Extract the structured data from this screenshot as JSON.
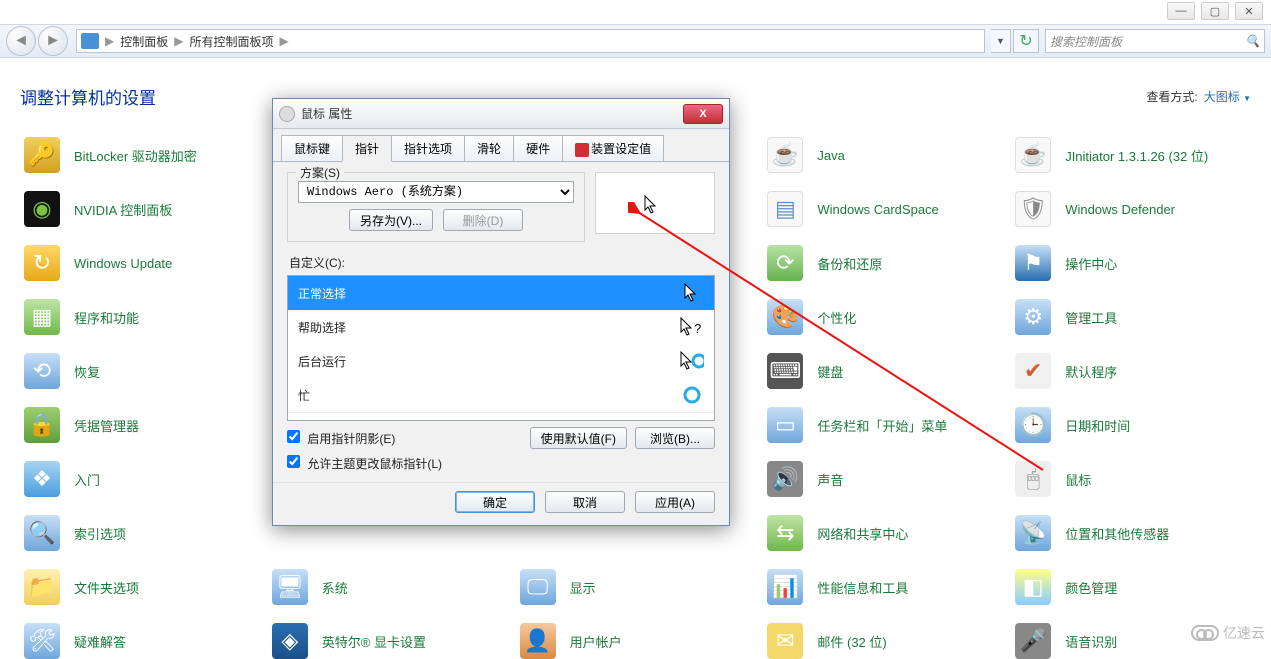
{
  "window_buttons": {
    "min": "—",
    "max": "▢",
    "close": "✕"
  },
  "breadcrumbs": {
    "seg1": "控制面板",
    "seg2": "所有控制面板项",
    "arrow": "▶"
  },
  "search_placeholder": "搜索控制面板",
  "page_title": "调整计算机的设置",
  "view_mode": {
    "label": "查看方式:",
    "value": "大图标",
    "tri": "▼"
  },
  "items": {
    "c0": [
      {
        "label": "BitLocker 驱动器加密",
        "cls": "ic-bitlocker",
        "g": "🔑"
      },
      {
        "label": "NVIDIA 控制面板",
        "cls": "ic-nvidia",
        "g": "◉"
      },
      {
        "label": "Windows Update",
        "cls": "ic-update",
        "g": "↻"
      },
      {
        "label": "程序和功能",
        "cls": "ic-programs",
        "g": "▦"
      },
      {
        "label": "恢复",
        "cls": "ic-recovery",
        "g": "⟲"
      },
      {
        "label": "凭据管理器",
        "cls": "ic-cred",
        "g": "🔒"
      },
      {
        "label": "入门",
        "cls": "ic-intro",
        "g": "❖"
      },
      {
        "label": "索引选项",
        "cls": "ic-index",
        "g": "🔍"
      },
      {
        "label": "文件夹选项",
        "cls": "ic-folder",
        "g": "📁"
      },
      {
        "label": "疑难解答",
        "cls": "ic-trouble",
        "g": "🛠"
      }
    ],
    "c1": [
      {
        "label": "系统",
        "cls": "ic-system",
        "g": "🖥"
      },
      {
        "label": "英特尔® 显卡设置",
        "cls": "ic-intel",
        "g": "◈"
      }
    ],
    "c2": [
      {
        "label": "显示",
        "cls": "ic-display",
        "g": "🖵"
      },
      {
        "label": "用户帐户",
        "cls": "ic-user",
        "g": "👤"
      }
    ],
    "c3": [
      {
        "label": "Java",
        "cls": "ic-java",
        "g": "☕"
      },
      {
        "label": "Windows CardSpace",
        "cls": "ic-cardspace",
        "g": "▤"
      },
      {
        "label": "备份和还原",
        "cls": "ic-backup",
        "g": "⟳"
      },
      {
        "label": "个性化",
        "cls": "ic-personal",
        "g": "🎨"
      },
      {
        "label": "键盘",
        "cls": "ic-keyboard",
        "g": "⌨"
      },
      {
        "label": "任务栏和「开始」菜单",
        "cls": "ic-taskbar",
        "g": "▭"
      },
      {
        "label": "声音",
        "cls": "ic-sound",
        "g": "🔊"
      },
      {
        "label": "网络和共享中心",
        "cls": "ic-network",
        "g": "⇆"
      },
      {
        "label": "性能信息和工具",
        "cls": "ic-perf",
        "g": "📊"
      },
      {
        "label": "邮件 (32 位)",
        "cls": "ic-mail",
        "g": "✉"
      }
    ],
    "c4": [
      {
        "label": "JInitiator 1.3.1.26 (32 位)",
        "cls": "ic-jinit",
        "g": "☕"
      },
      {
        "label": "Windows Defender",
        "cls": "ic-defender",
        "g": "🛡"
      },
      {
        "label": "操作中心",
        "cls": "ic-action",
        "g": "⚑"
      },
      {
        "label": "管理工具",
        "cls": "ic-admin",
        "g": "⚙"
      },
      {
        "label": "默认程序",
        "cls": "ic-default",
        "g": "✔"
      },
      {
        "label": "日期和时间",
        "cls": "ic-date",
        "g": "🕒"
      },
      {
        "label": "鼠标",
        "cls": "ic-mouse",
        "g": "🖱"
      },
      {
        "label": "位置和其他传感器",
        "cls": "ic-location",
        "g": "📡"
      },
      {
        "label": "颜色管理",
        "cls": "ic-color",
        "g": "◧"
      },
      {
        "label": "语音识别",
        "cls": "ic-speech",
        "g": "🎤"
      }
    ]
  },
  "dialog": {
    "title": "鼠标 属性",
    "tabs": [
      "鼠标键",
      "指针",
      "指针选项",
      "滑轮",
      "硬件",
      "装置设定值"
    ],
    "active_tab": 1,
    "scheme_legend": "方案(S)",
    "scheme_value": "Windows Aero (系统方案)",
    "save_as": "另存为(V)...",
    "delete": "删除(D)",
    "custom_label": "自定义(C):",
    "cursors": [
      {
        "name": "正常选择",
        "icon": "arrow",
        "selected": true
      },
      {
        "name": "帮助选择",
        "icon": "help"
      },
      {
        "name": "后台运行",
        "icon": "appwait"
      },
      {
        "name": "忙",
        "icon": "wait"
      }
    ],
    "shadow_chk": "启用指针阴影(E)",
    "theme_chk": "允许主题更改鼠标指针(L)",
    "use_default": "使用默认值(F)",
    "browse": "浏览(B)...",
    "ok": "确定",
    "cancel": "取消",
    "apply": "应用(A)"
  },
  "watermark": "亿速云"
}
